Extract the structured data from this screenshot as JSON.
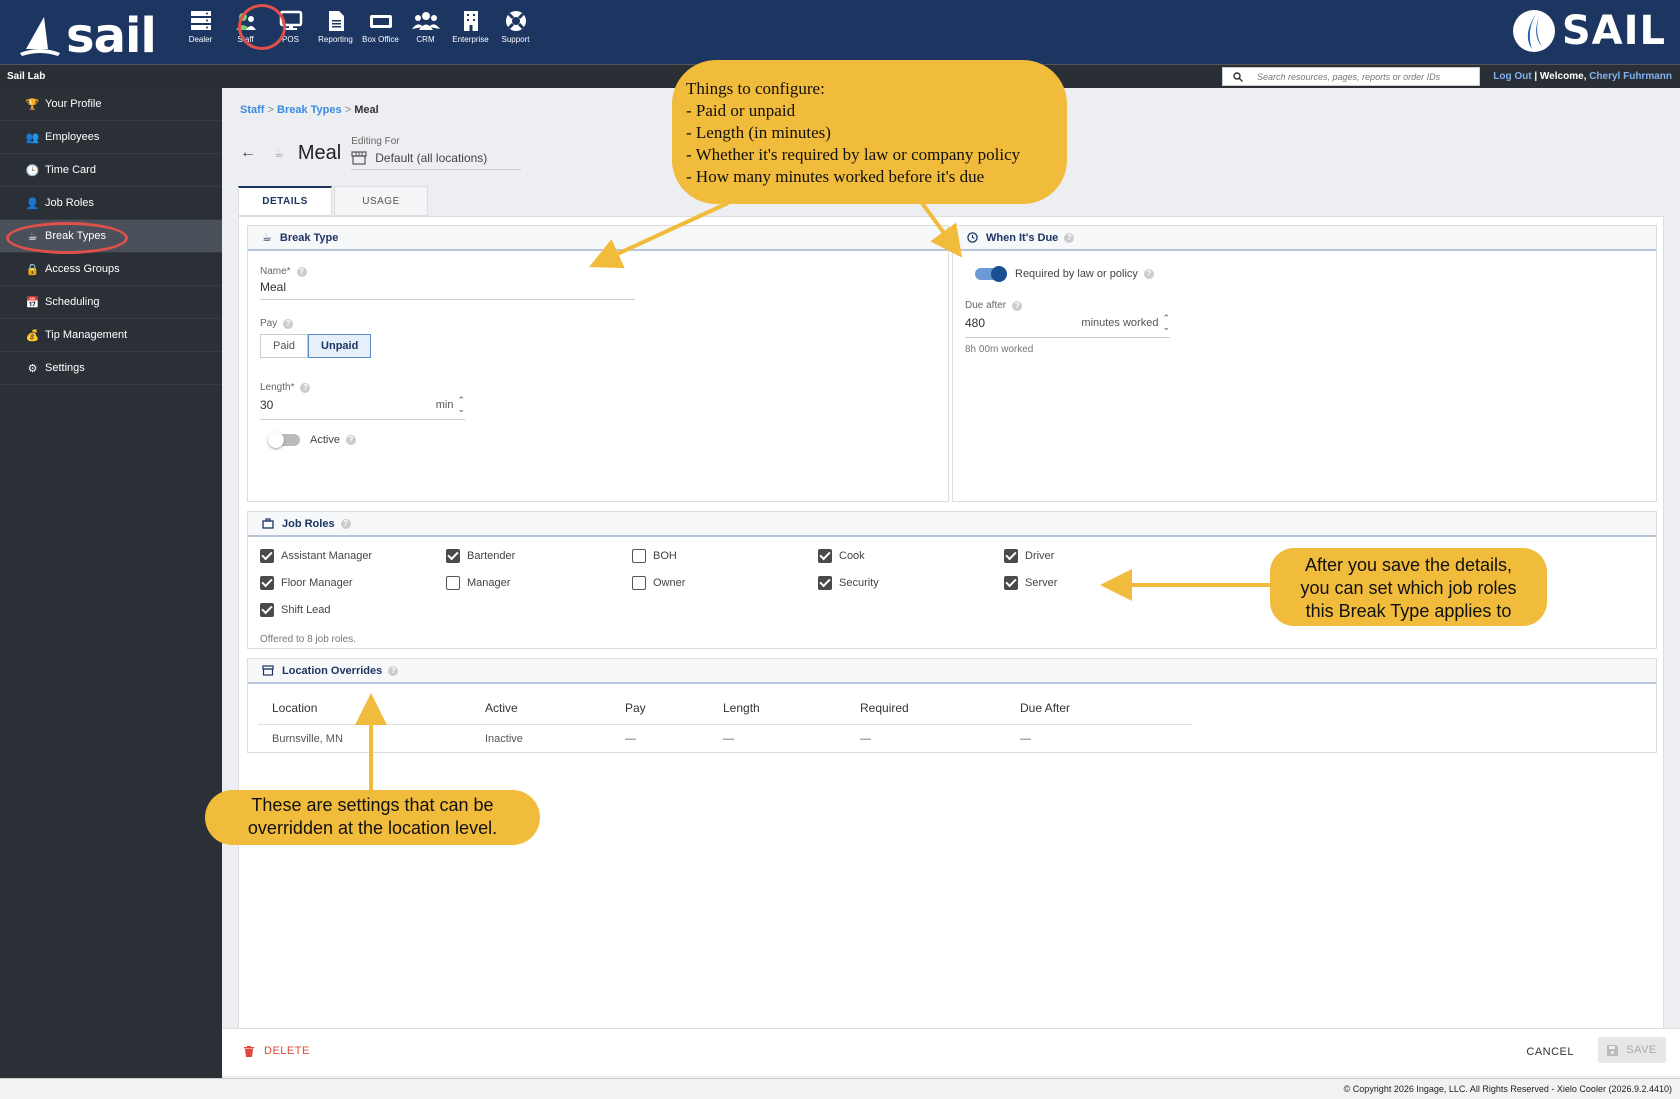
{
  "brand": {
    "app_logo": "sail",
    "brand_logo": "SAIL"
  },
  "topnav": [
    {
      "label": "Dealer",
      "icon": "server-icon"
    },
    {
      "label": "Staff",
      "icon": "people-icon"
    },
    {
      "label": "POS",
      "icon": "monitor-icon"
    },
    {
      "label": "Reporting",
      "icon": "document-icon"
    },
    {
      "label": "Box Office",
      "icon": "ticket-icon"
    },
    {
      "label": "CRM",
      "icon": "group-icon"
    },
    {
      "label": "Enterprise",
      "icon": "building-icon"
    },
    {
      "label": "Support",
      "icon": "lifebuoy-icon"
    }
  ],
  "subbar": {
    "org": "Sail Lab",
    "search_placeholder": "Search resources, pages, reports or order IDs",
    "logout": "Log Out",
    "welcome": "Welcome,",
    "user": "Cheryl Fuhrmann"
  },
  "sidebar": [
    {
      "label": "Your Profile",
      "icon": "profile-icon"
    },
    {
      "label": "Employees",
      "icon": "employees-icon"
    },
    {
      "label": "Time Card",
      "icon": "clock-icon"
    },
    {
      "label": "Job Roles",
      "icon": "person-icon"
    },
    {
      "label": "Break Types",
      "icon": "coffee-icon",
      "active": true
    },
    {
      "label": "Access Groups",
      "icon": "lock-icon"
    },
    {
      "label": "Scheduling",
      "icon": "calendar-icon"
    },
    {
      "label": "Tip Management",
      "icon": "tip-icon"
    },
    {
      "label": "Settings",
      "icon": "settings-icon"
    }
  ],
  "breadcrumb": {
    "staff": "Staff",
    "break_types": "Break Types",
    "current": "Meal",
    "sep": ">"
  },
  "page": {
    "title": "Meal",
    "editing_for_label": "Editing For",
    "editing_for_value": "Default (all locations)"
  },
  "tabs": {
    "details": "DETAILS",
    "usage": "USAGE"
  },
  "break_type": {
    "heading": "Break Type",
    "name_label": "Name*",
    "name_value": "Meal",
    "pay_label": "Pay",
    "pay_paid": "Paid",
    "pay_unpaid": "Unpaid",
    "length_label": "Length*",
    "length_value": "30",
    "length_unit": "min",
    "active_label": "Active"
  },
  "when_due": {
    "heading": "When It's Due",
    "required_label": "Required by law or policy",
    "due_after_label": "Due after",
    "due_after_value": "480",
    "due_after_unit": "minutes worked",
    "hint": "8h 00m worked"
  },
  "job_roles": {
    "heading": "Job Roles",
    "roles": [
      {
        "label": "Assistant Manager",
        "checked": true
      },
      {
        "label": "Bartender",
        "checked": true
      },
      {
        "label": "BOH",
        "checked": false
      },
      {
        "label": "Cook",
        "checked": true
      },
      {
        "label": "Driver",
        "checked": true
      },
      {
        "label": "Floor Manager",
        "checked": true
      },
      {
        "label": "Manager",
        "checked": false
      },
      {
        "label": "Owner",
        "checked": false
      },
      {
        "label": "Security",
        "checked": true
      },
      {
        "label": "Server",
        "checked": true
      },
      {
        "label": "Shift Lead",
        "checked": true
      }
    ],
    "summary": "Offered to 8 job roles."
  },
  "overrides": {
    "heading": "Location Overrides",
    "columns": [
      "Location",
      "Active",
      "Pay",
      "Length",
      "Required",
      "Due After"
    ],
    "rows": [
      [
        "Burnsville, MN",
        "Inactive",
        "—",
        "—",
        "—",
        "—"
      ]
    ]
  },
  "footer": {
    "delete": "DELETE",
    "cancel": "CANCEL",
    "save": "SAVE"
  },
  "copyright": "© Copyright 2026 Ingage, LLC. All Rights Reserved - Xielo Cooler (2026.9.2.4410)",
  "callouts": {
    "configure": [
      "Things to configure:",
      "- Paid or unpaid",
      "- Length (in minutes)",
      "- Whether it's required by law or company policy",
      "- How many minutes worked before it's due"
    ],
    "job_roles": [
      "After you save the details,",
      "you can set which job roles",
      "this Break Type applies to"
    ],
    "overrides": [
      "These are settings that can be",
      "overridden at the location level."
    ]
  },
  "colors": {
    "navy": "#1c3561",
    "sidebar": "#2b2f36",
    "callout": "#f1bb3b",
    "ring": "#e0504a",
    "link": "#3d8ae0",
    "danger": "#e04a3a"
  }
}
